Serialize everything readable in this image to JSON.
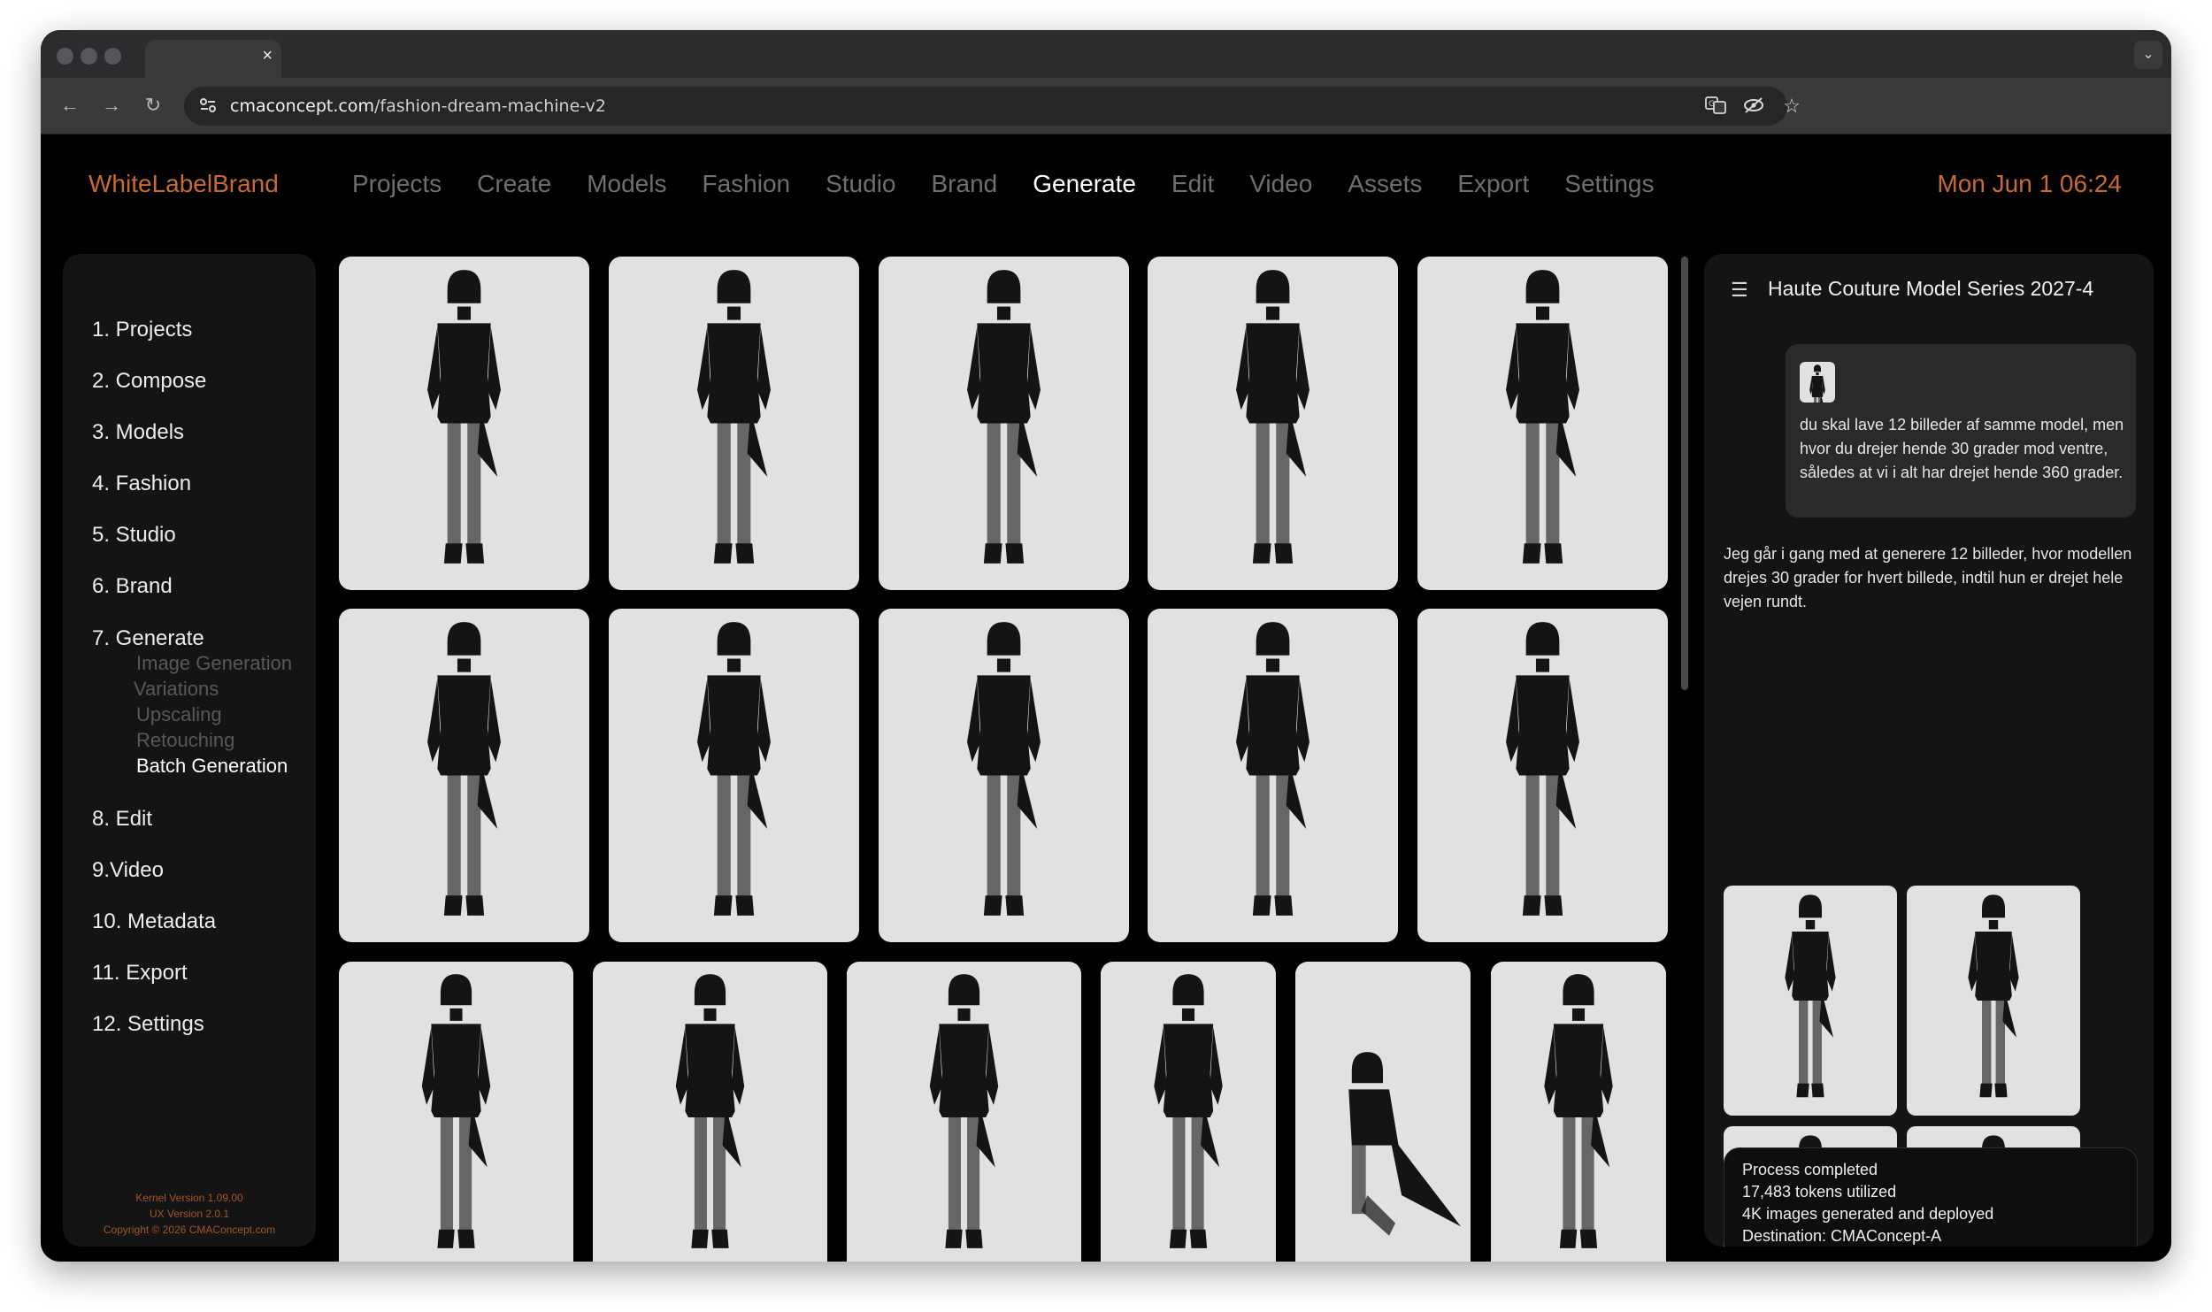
{
  "browser": {
    "tab_close": "×",
    "tab_menu": "⌄",
    "url_domain": "cmaconcept.com",
    "url_path": "/fashion-dream-machine-v2"
  },
  "header": {
    "brand": "WhiteLabelBrand",
    "nav": [
      "Projects",
      "Create",
      "Models",
      "Fashion",
      "Studio",
      "Brand",
      "Generate",
      "Edit",
      "Video",
      "Assets",
      "Export",
      "Settings"
    ],
    "active_nav": "Generate",
    "clock": "Mon Jun 1 06:24"
  },
  "sidebar": {
    "items": [
      "1. Projects",
      "2. Compose",
      "3. Models",
      "4. Fashion",
      "5. Studio",
      "6. Brand",
      "7. Generate",
      "8. Edit",
      "9.Video",
      "10. Metadata",
      "11. Export",
      "12. Settings"
    ],
    "sub_items": [
      "Image Generation",
      "Variations",
      "Upscaling",
      "Retouching",
      "Batch Generation"
    ],
    "active_sub": "Batch Generation",
    "version_lines": [
      "Kernel Version 1.09.00",
      "UX Version 2.0.1",
      "Copyright © 2026 CMAConcept.com"
    ]
  },
  "panel": {
    "title": "Haute Couture Model Series 2027-4",
    "user_message": "du skal lave 12 billeder af samme model, men hvor du drejer hende 30 grader mod ventre, således at vi i alt har drejet hende 360 grader.",
    "assistant_reply": "Jeg går i gang med at generere 12 billeder, hvor modellen drejes 30 grader for hvert billede, indtil hun er drejet hele vejen rundt.",
    "status_lines": [
      "Process completed",
      "17,483 tokens utilized",
      "4K images generated and deployed",
      "Destination: CMAConcept-A"
    ]
  },
  "theme": {
    "accent": "#c86a34",
    "background": "#000000",
    "panel": "#141414",
    "tile_bg": "#e1e1e3",
    "figure": "#141414"
  }
}
